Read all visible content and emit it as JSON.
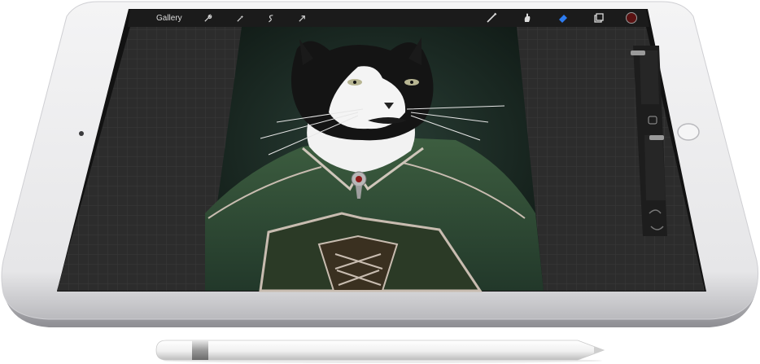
{
  "app": {
    "toolbar": {
      "gallery_label": "Gallery",
      "left_tool_icons": [
        "wrench-icon",
        "magic-wand-icon",
        "selection-icon",
        "transform-arrow-icon"
      ],
      "right_tool_icons": [
        "brush-icon",
        "smudge-icon",
        "eraser-icon",
        "layers-icon",
        "color-swatch-icon"
      ],
      "active_color": "#5a1212",
      "eraser_accent": "#2d7cf0"
    },
    "sidebar": {
      "brush_size_level": 0.06,
      "opacity_level": 0.55,
      "icons": [
        "square-modify-icon",
        "undo-icon",
        "redo-icon"
      ]
    },
    "canvas": {
      "artwork_description_hidden": ""
    }
  },
  "colors": {
    "device_silver": "#e9e9eb",
    "screen_bg": "#2e2e2e",
    "toolbar_bg": "#1c1c1c",
    "art_bg": "#18261f",
    "cloak_green": "#2e4a32"
  }
}
